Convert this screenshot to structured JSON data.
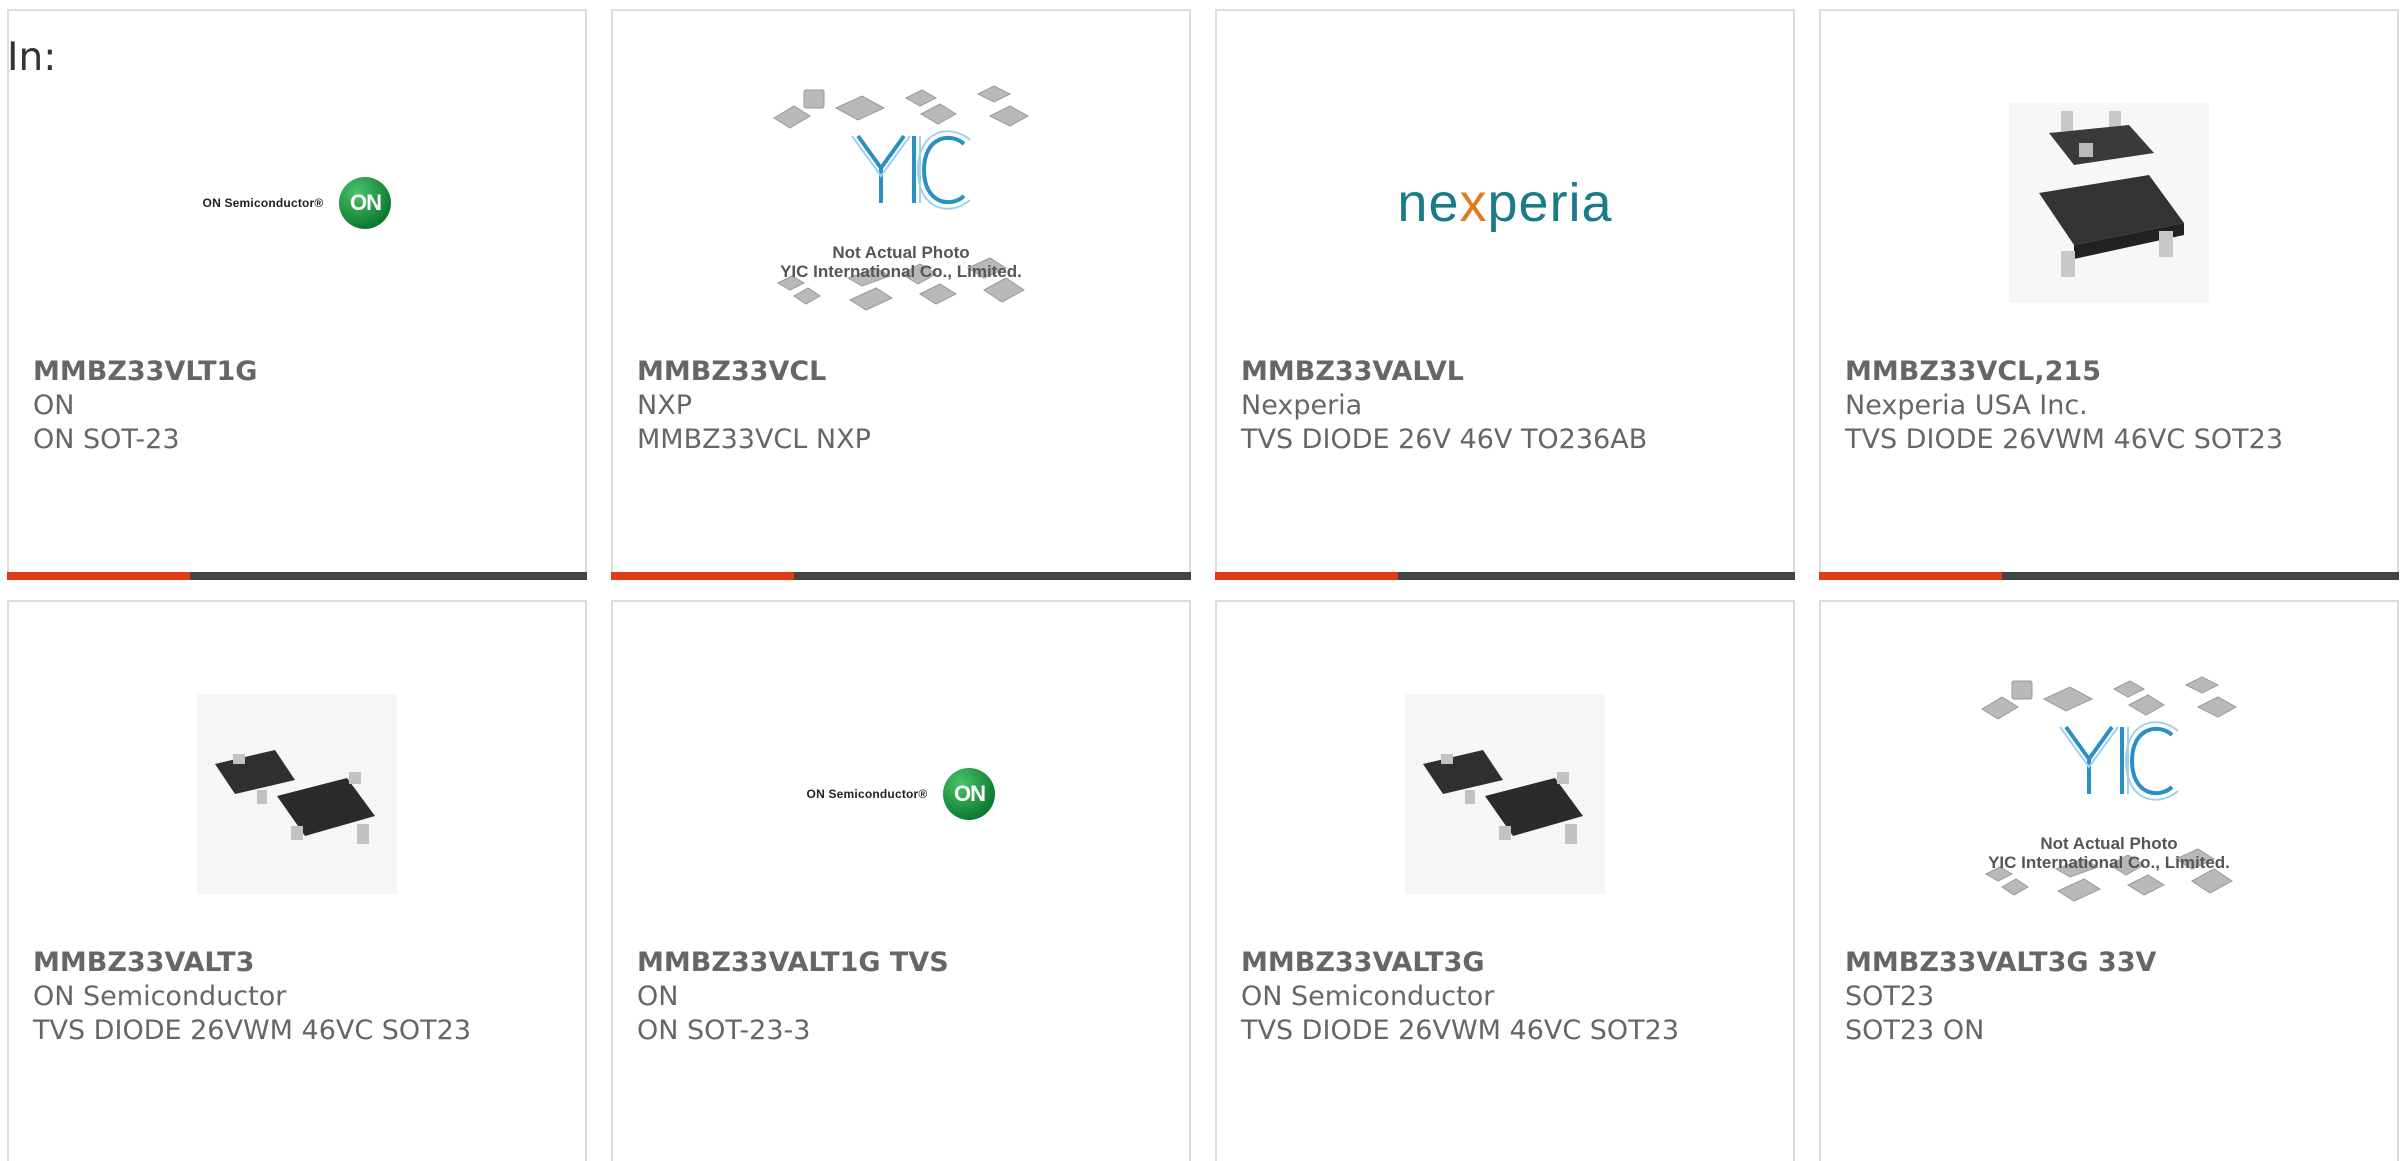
{
  "header": {
    "in_label": "In:"
  },
  "colors": {
    "accent": "#e2391b",
    "bar": "#444444",
    "text": "#666666",
    "border": "#dddddd"
  },
  "products": [
    {
      "part_number": "MMBZ33VLT1G",
      "manufacturer": "ON",
      "description": "ON SOT-23",
      "image": "on-semiconductor-logo",
      "logo_text": "ON Semiconductor®",
      "logo_badge": "ON"
    },
    {
      "part_number": "MMBZ33VCL",
      "manufacturer": "NXP",
      "description": "MMBZ33VCL NXP",
      "image": "yic-placeholder",
      "note_line1": "Not Actual Photo",
      "note_line2": "YIC International Co., Limited."
    },
    {
      "part_number": "MMBZ33VALVL",
      "manufacturer": "Nexperia",
      "description": "TVS DIODE 26V 46V TO236AB",
      "image": "nexperia-logo",
      "logo_pre": "ne",
      "logo_x": "x",
      "logo_post": "peria"
    },
    {
      "part_number": "MMBZ33VCL,215",
      "manufacturer": "Nexperia USA Inc.",
      "description": "TVS DIODE 26VWM 46VC SOT23",
      "image": "sot23-chip-photo"
    },
    {
      "part_number": "MMBZ33VALT3",
      "manufacturer": "ON Semiconductor",
      "description": "TVS DIODE 26VWM 46VC SOT23",
      "image": "sot23-pair-photo"
    },
    {
      "part_number": "MMBZ33VALT1G TVS",
      "manufacturer": "ON",
      "description": "ON SOT-23-3",
      "image": "on-semiconductor-logo",
      "logo_text": "ON Semiconductor®",
      "logo_badge": "ON"
    },
    {
      "part_number": "MMBZ33VALT3G",
      "manufacturer": "ON Semiconductor",
      "description": "TVS DIODE 26VWM 46VC SOT23",
      "image": "sot23-pair-photo"
    },
    {
      "part_number": "MMBZ33VALT3G 33V",
      "manufacturer": "SOT23",
      "description": "SOT23 ON",
      "image": "yic-placeholder",
      "note_line1": "Not Actual Photo",
      "note_line2": "YIC International Co., Limited."
    }
  ]
}
